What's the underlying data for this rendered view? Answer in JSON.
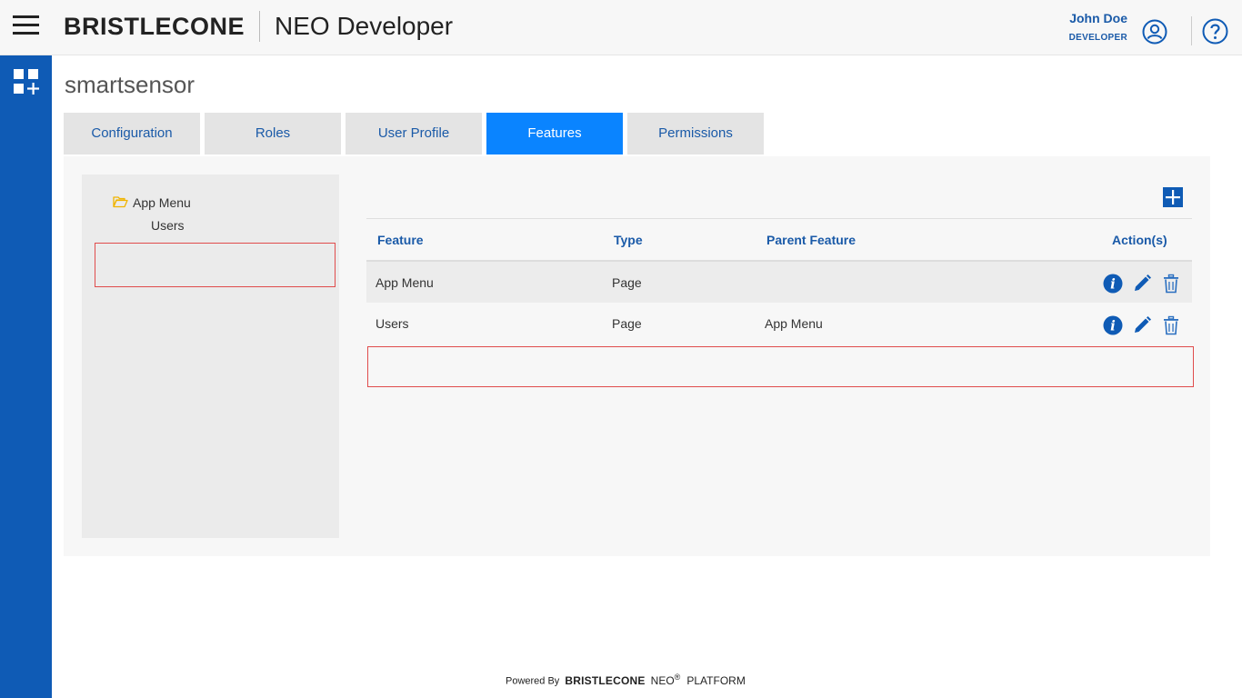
{
  "header": {
    "brand": "BRISTLECONE",
    "app_title": "NEO Developer",
    "user_name": "John Doe",
    "user_role": "DEVELOPER"
  },
  "page": {
    "title": "smartsensor"
  },
  "tabs": [
    {
      "label": "Configuration",
      "active": false
    },
    {
      "label": "Roles",
      "active": false
    },
    {
      "label": "User Profile",
      "active": false
    },
    {
      "label": "Features",
      "active": true
    },
    {
      "label": "Permissions",
      "active": false
    }
  ],
  "tree": {
    "root": "App Menu",
    "child": "Users"
  },
  "table": {
    "headers": [
      "Feature",
      "Type",
      "Parent Feature",
      "Action(s)"
    ],
    "rows": [
      {
        "feature": "App Menu",
        "type": "Page",
        "parent": ""
      },
      {
        "feature": "Users",
        "type": "Page",
        "parent": "App Menu"
      }
    ]
  },
  "footer": {
    "powered_by": "Powered By",
    "brand": "BRISTLECONE",
    "neo": "NEO",
    "reg": "®",
    "platform": "PLATFORM"
  },
  "colors": {
    "primary": "#0f5bb5",
    "active_tab": "#0a84ff",
    "link_text": "#1a5aa8",
    "highlight_border": "#e04c4c"
  }
}
